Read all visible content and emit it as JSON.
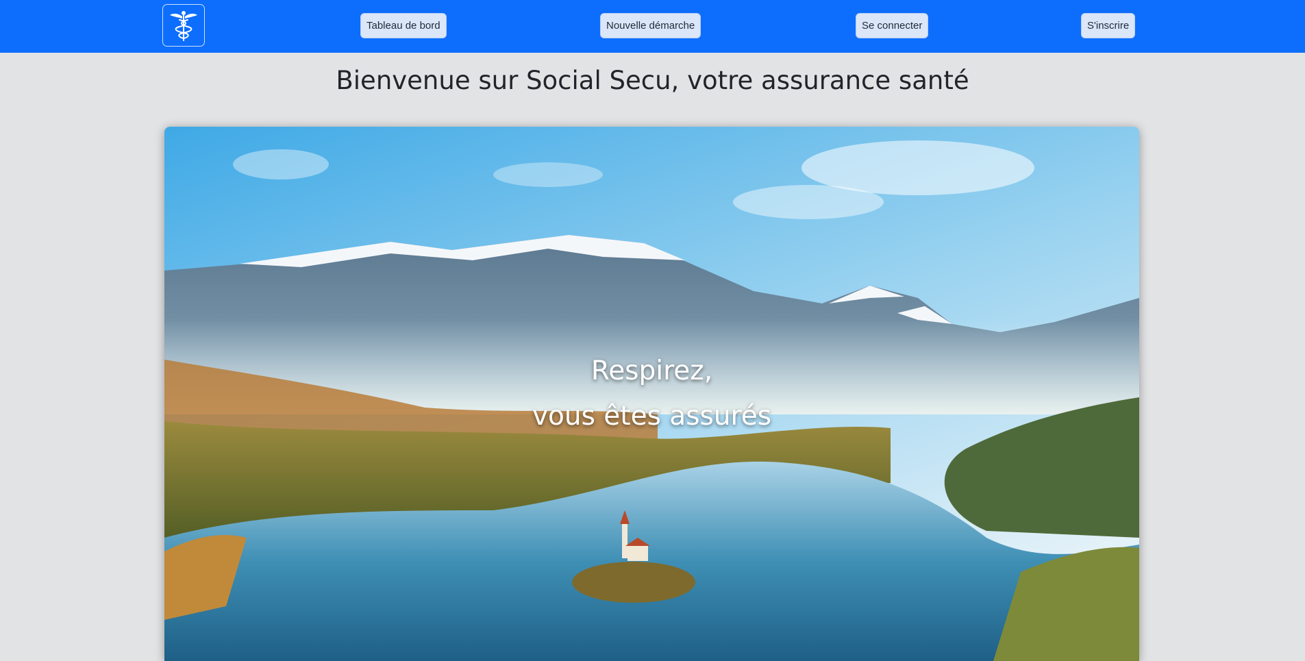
{
  "nav": {
    "logo_icon": "caduceus-icon",
    "items": [
      {
        "label": "Tableau de bord"
      },
      {
        "label": "Nouvelle démarche"
      },
      {
        "label": "Se connecter"
      },
      {
        "label": "S'inscrire"
      }
    ]
  },
  "page": {
    "title": "Bienvenue sur Social Secu, votre assurance santé"
  },
  "hero": {
    "line1": "Respirez,",
    "line2": "vous êtes assurés"
  },
  "colors": {
    "navbar": "#0d6efd",
    "background": "#e2e3e5"
  }
}
